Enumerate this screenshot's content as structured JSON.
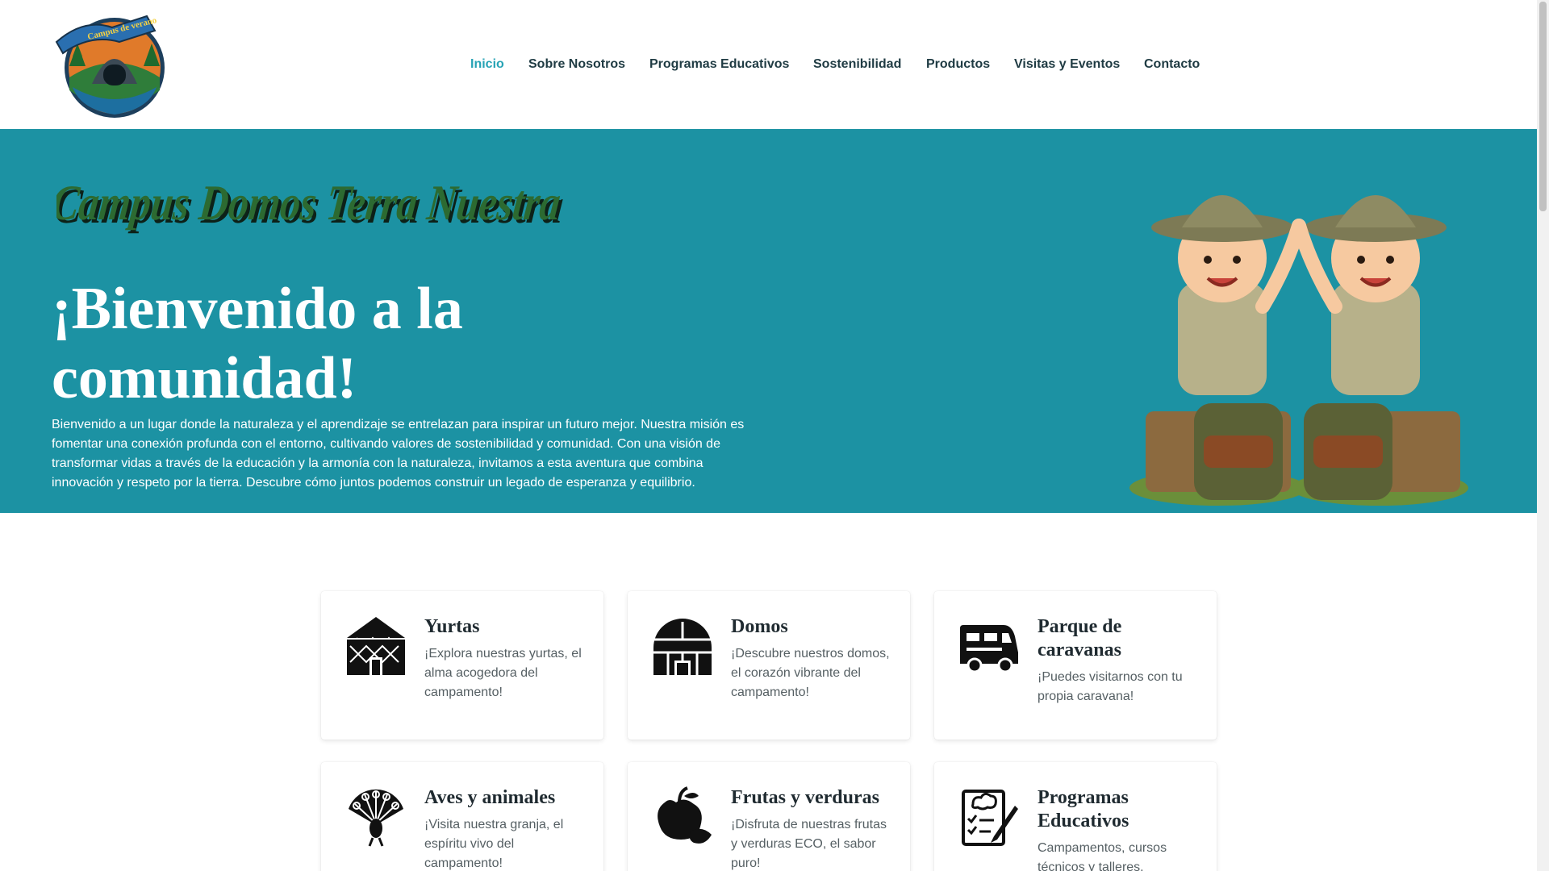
{
  "header": {
    "logo_label": "Campus de verano",
    "nav": [
      {
        "label": "Inicio",
        "active": true
      },
      {
        "label": "Sobre Nosotros",
        "active": false
      },
      {
        "label": "Programas Educativos",
        "active": false
      },
      {
        "label": "Sostenibilidad",
        "active": false
      },
      {
        "label": "Productos",
        "active": false
      },
      {
        "label": "Visitas y Eventos",
        "active": false
      },
      {
        "label": "Contacto",
        "active": false
      }
    ]
  },
  "hero": {
    "logo_text": "Campus Domos Terra Nuestra",
    "title": "¡Bienvenido a la comunidad!",
    "description": "Bienvenido a un lugar donde la naturaleza y el aprendizaje se entrelazan para inspirar un futuro mejor. Nuestra misión es fomentar una conexión profunda con el entorno, cultivando valores de sostenibilidad y comunidad. Con una visión de transformar vidas a través de la educación y la armonía con la naturaleza, invitamos a esta aventura que combina innovación y respeto por la tierra. Descubre cómo juntos podemos construir un legado de esperanza y equilibrio."
  },
  "cards": [
    {
      "icon": "yurt-icon",
      "title": "Yurtas",
      "text": "¡Explora nuestras yurtas, el alma acogedora del campamento!"
    },
    {
      "icon": "dome-icon",
      "title": "Domos",
      "text": "¡Descubre nuestros domos, el corazón vibrante del campamento!"
    },
    {
      "icon": "caravan-icon",
      "title": "Parque de caravanas",
      "text": "¡Puedes visitarnos con tu propia caravana!"
    },
    {
      "icon": "peacock-icon",
      "title": "Aves y animales",
      "text": "¡Visita nuestra granja, el espíritu vivo del campamento!"
    },
    {
      "icon": "fruits-icon",
      "title": "Frutas y verduras",
      "text": "¡Disfruta de nuestras frutas y verduras ECO, el sabor puro!"
    },
    {
      "icon": "education-icon",
      "title": "Programas Educativos",
      "text": "Campamentos, cursos técnicos y talleres."
    }
  ],
  "colors": {
    "accent": "#27a3b5",
    "hero_bg": "#1c92a3",
    "nav_text": "#1f3b43"
  }
}
